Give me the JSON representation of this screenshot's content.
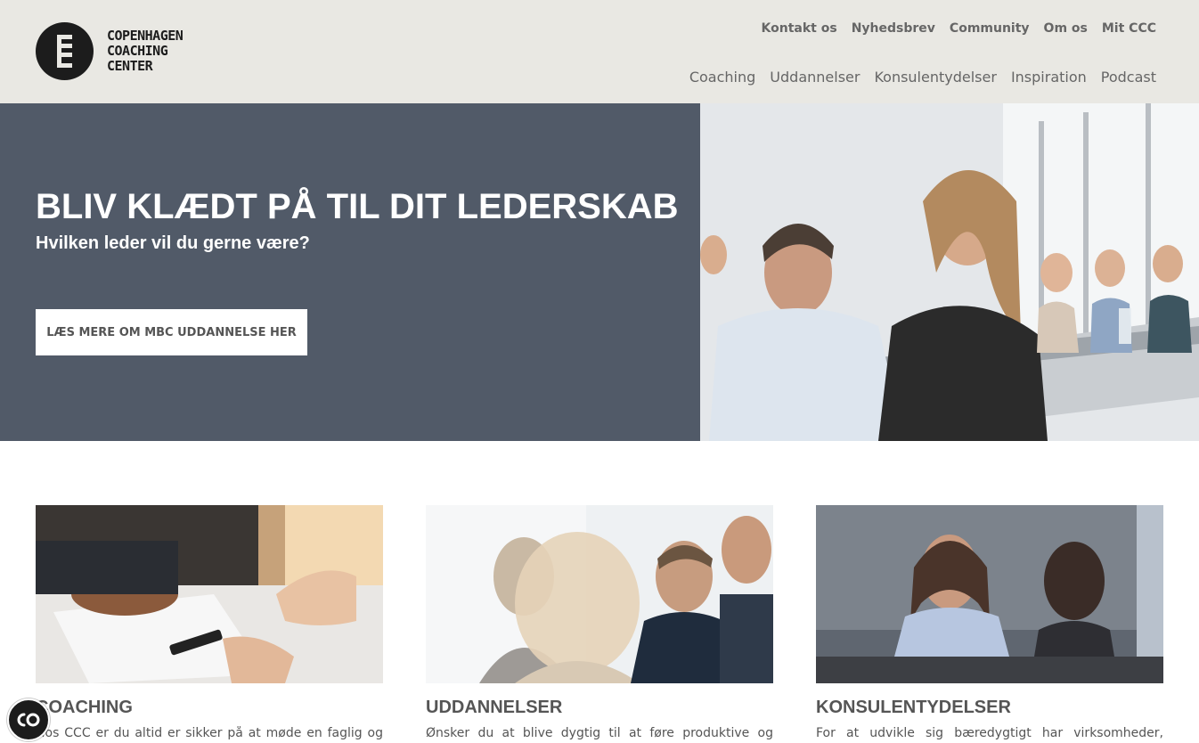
{
  "logo": {
    "lines": [
      "COPENHAGEN",
      "COACHING",
      "CENTER"
    ]
  },
  "top_nav": [
    "Kontakt os",
    "Nyhedsbrev",
    "Community",
    "Om os",
    "Mit CCC"
  ],
  "main_nav": [
    "Coaching",
    "Uddannelser",
    "Konsulentydelser",
    "Inspiration",
    "Podcast"
  ],
  "hero": {
    "title": "BLIV KLÆDT PÅ TIL DIT LEDERSKAB",
    "subtitle": "Hvilken leder vil du gerne være?",
    "button_label": "LÆS MERE OM MBC UDDANNELSE HER",
    "background_color": "#515a68"
  },
  "cards": [
    {
      "title": "COACHING",
      "text": "Hos CCC er du altid er sikker på at møde en faglig og"
    },
    {
      "title": "UDDANNELSER",
      "text": "Ønsker du at blive dygtig til at føre produktive og"
    },
    {
      "title": "KONSULENTYDELSER",
      "text": "For at udvikle sig bæredygtigt har virksomheder,"
    }
  ],
  "icons": {
    "logo_mark": "ccc-logo-icon",
    "accessibility": "accessibility-icon"
  },
  "colors": {
    "header_bg": "#e9e8e3",
    "hero_panel": "#515a68",
    "text": "#555555"
  }
}
